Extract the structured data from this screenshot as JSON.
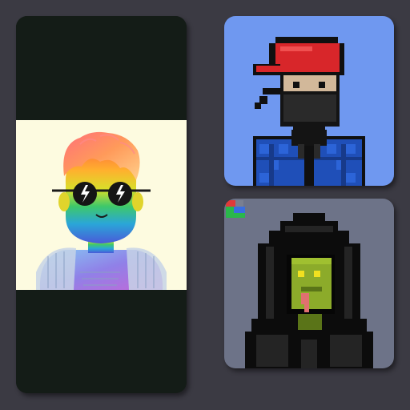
{
  "gallery": {
    "background": "#3b3a43",
    "cards": [
      {
        "icon": "rainbow-avatar-with-sunglasses-icon",
        "frame_color": "#141c17",
        "image_background": "#fdfbe0"
      },
      {
        "icon": "pixel-ninja-red-cap-icon",
        "background": "#6f98f0"
      },
      {
        "icon": "pixel-hooded-lizard-icon",
        "background": "#6d7388"
      }
    ]
  }
}
